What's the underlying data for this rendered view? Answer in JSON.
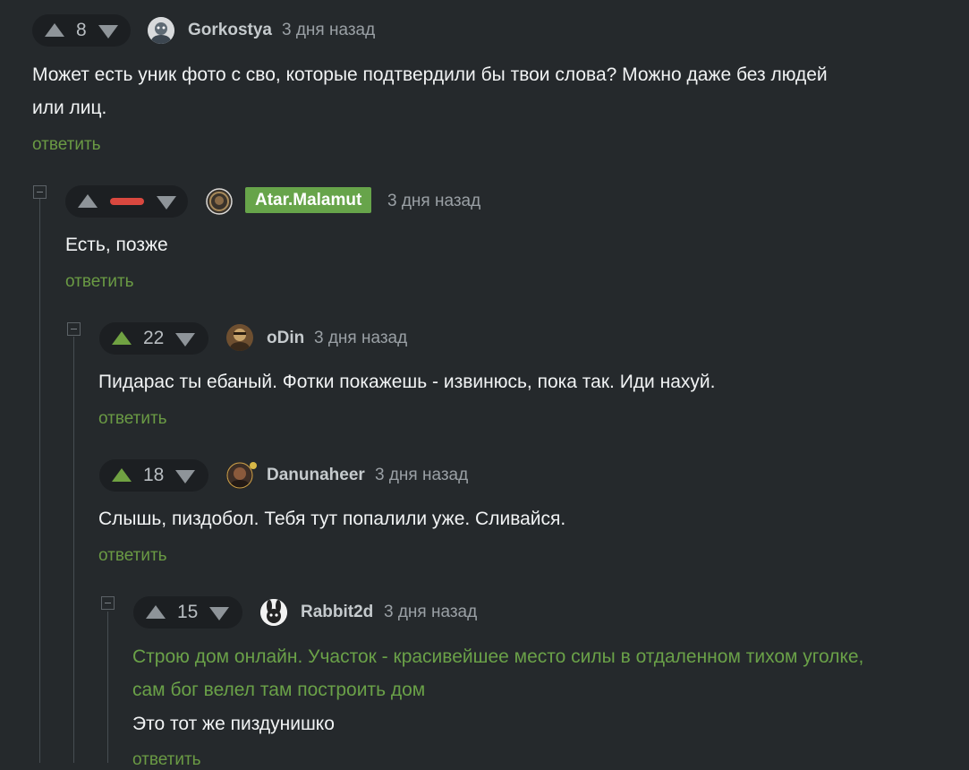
{
  "comments": [
    {
      "id": "c1",
      "score": "8",
      "username": "Gorkostya",
      "time": "3 дня назад",
      "text_lines": [
        "Может есть уник фото с сво, которые подтвердили бы твои слова? Можно даже без людей",
        "или лиц."
      ],
      "reply_label": "ответить"
    },
    {
      "id": "c2",
      "score": "",
      "score_indicator": "negative-bar",
      "username": "Atar.Malamut",
      "username_badge_color": "#67a44a",
      "time": "3 дня назад",
      "text": "Есть, позже",
      "reply_label": "ответить"
    },
    {
      "id": "c3",
      "score": "22",
      "upvoted": true,
      "username": "oDin",
      "time": "3 дня назад",
      "text": "Пидарас ты ебаный. Фотки покажешь - извинюсь, пока так. Иди нахуй.",
      "reply_label": "ответить"
    },
    {
      "id": "c4",
      "score": "18",
      "upvoted": true,
      "username": "Danunaheer",
      "time": "3 дня назад",
      "text": "Слышь, пиздобол. Тебя тут попалили уже. Сливайся.",
      "reply_label": "ответить"
    },
    {
      "id": "c5",
      "score": "15",
      "username": "Rabbit2d",
      "time": "3 дня назад",
      "quote_lines": [
        "Строю дом онлайн. Участок - красивейшее место силы в отдаленном тихом уголке,",
        "сам бог велел там построить дом"
      ],
      "text": "Это тот же пиздунишко",
      "reply_label": "ответить"
    }
  ],
  "colors": {
    "background": "#25292c",
    "upvote_active": "#70a242",
    "negative": "#d9483f",
    "reply_link": "#6a9a44",
    "quote_text": "#6aa148"
  }
}
